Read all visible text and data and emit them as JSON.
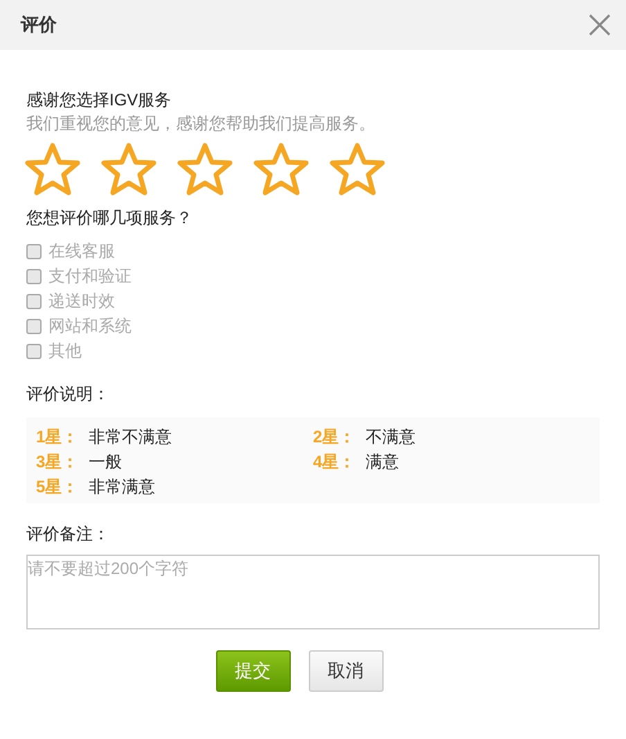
{
  "dialog": {
    "title": "评价"
  },
  "intro": {
    "heading": "感谢您选择IGV服务",
    "subtitle": "我们重视您的意见，感谢您帮助我们提高服务。"
  },
  "rating": {
    "stars": 0
  },
  "services": {
    "question": "您想评价哪几项服务？",
    "options": [
      {
        "label": "在线客服",
        "checked": false
      },
      {
        "label": "支付和验证",
        "checked": false
      },
      {
        "label": "递送时效",
        "checked": false
      },
      {
        "label": "网站和系统",
        "checked": false
      },
      {
        "label": "其他",
        "checked": false
      }
    ]
  },
  "legend": {
    "title": "评价说明：",
    "items": [
      {
        "key": "1星：",
        "meaning": "非常不满意"
      },
      {
        "key": "2星：",
        "meaning": "不满意"
      },
      {
        "key": "3星：",
        "meaning": "一般"
      },
      {
        "key": "4星：",
        "meaning": "满意"
      },
      {
        "key": "5星：",
        "meaning": "非常满意"
      }
    ]
  },
  "remarks": {
    "label": "评价备注：",
    "placeholder": "请不要超过200个字符"
  },
  "buttons": {
    "submit": "提交",
    "cancel": "取消"
  }
}
